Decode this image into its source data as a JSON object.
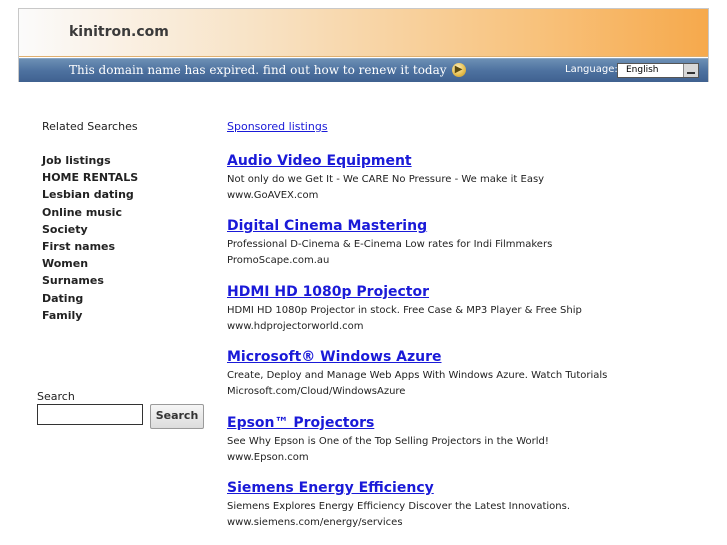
{
  "header": {
    "site_title": "kinitron.com",
    "expired_message": "This domain name has expired. find out how to renew it today",
    "language_label": "Language:",
    "language_selected": "English",
    "colors": {
      "header_top_from": "#fbfbfb",
      "header_top_to": "#f6a94c",
      "bar_blue": "#4e72a0"
    }
  },
  "related": {
    "title": "Related Searches",
    "items": [
      {
        "label": "Job listings"
      },
      {
        "label": "HOME RENTALS"
      },
      {
        "label": "Lesbian dating"
      },
      {
        "label": "Online music"
      },
      {
        "label": "Society"
      },
      {
        "label": "First names"
      },
      {
        "label": "Women"
      },
      {
        "label": "Surnames"
      },
      {
        "label": "Dating"
      },
      {
        "label": "Family"
      }
    ]
  },
  "search": {
    "label": "Search",
    "input_value": "",
    "button_label": "Search"
  },
  "sponsored": {
    "label": "Sponsored listings",
    "link_color": "#1a1ad8",
    "listings": [
      {
        "title": "Audio Video Equipment",
        "description": "Not only do we Get It - We CARE No Pressure - We make it Easy",
        "url": "www.GoAVEX.com"
      },
      {
        "title": "Digital Cinema Mastering",
        "description": "Professional D-Cinema & E-Cinema Low rates for Indi Filmmakers",
        "url": "PromoScape.com.au"
      },
      {
        "title": "HDMI HD 1080p Projector",
        "description": "HDMI HD 1080p Projector in stock. Free Case & MP3 Player & Free Ship",
        "url": "www.hdprojectorworld.com"
      },
      {
        "title": "Microsoft® Windows Azure",
        "description": "Create, Deploy and Manage Web Apps With Windows Azure. Watch Tutorials",
        "url": "Microsoft.com/Cloud/WindowsAzure"
      },
      {
        "title": "Epson™ Projectors",
        "description": "See Why Epson is One of the Top Selling Projectors in the World!",
        "url": "www.Epson.com"
      },
      {
        "title": "Siemens Energy Efficiency",
        "description": "Siemens Explores Energy Efficiency Discover the Latest Innovations.",
        "url": "www.siemens.com/energy/services"
      }
    ]
  }
}
